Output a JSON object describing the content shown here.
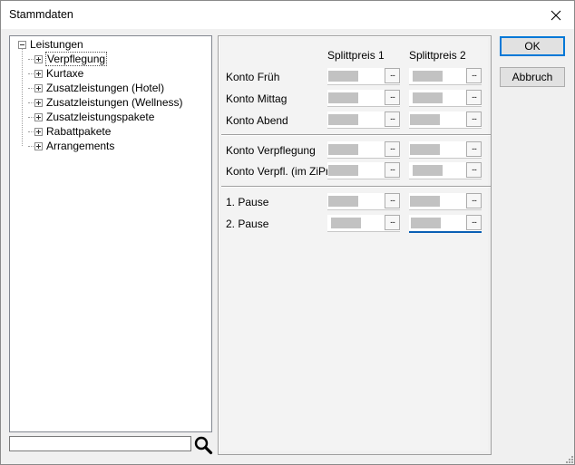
{
  "window": {
    "title": "Stammdaten"
  },
  "tree": {
    "root": "Leistungen",
    "children": [
      {
        "label": "Verpflegung",
        "selected": true
      },
      {
        "label": "Kurtaxe"
      },
      {
        "label": "Zusatzleistungen (Hotel)"
      },
      {
        "label": "Zusatzleistungen (Wellness)"
      },
      {
        "label": "Zusatzleistungspakete"
      },
      {
        "label": "Rabattpakete"
      },
      {
        "label": "Arrangements"
      }
    ]
  },
  "search": {
    "value": "",
    "placeholder": ""
  },
  "grid": {
    "col1": "Splittpreis 1",
    "col2": "Splittpreis 2",
    "rows": [
      {
        "label": "Konto Früh"
      },
      {
        "label": "Konto Mittag"
      },
      {
        "label": "Konto Abend"
      },
      {
        "label": "Konto Verpflegung"
      },
      {
        "label": "Konto Verpfl. (im ZiPr)"
      },
      {
        "label": "1. Pause"
      },
      {
        "label": "2. Pause"
      }
    ],
    "browse_label": "..."
  },
  "buttons": {
    "ok": "OK",
    "cancel": "Abbruch"
  },
  "icons": {
    "close": "close-icon",
    "search": "magnifier-icon",
    "expand": "plus-box-icon",
    "collapse": "minus-box-icon"
  },
  "colors": {
    "focus_accent": "#0a5fb4",
    "default_button_border": "#0078d7"
  }
}
